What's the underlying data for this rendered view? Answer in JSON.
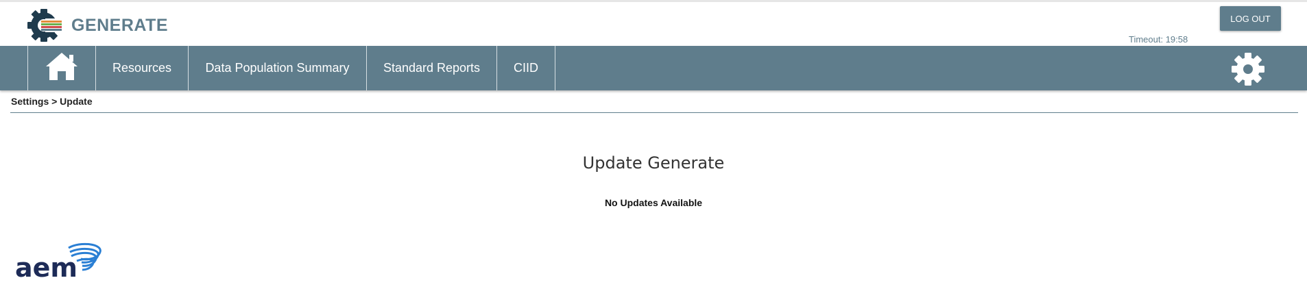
{
  "header": {
    "app_name": "GENERATE",
    "logout_label": "LOG OUT",
    "timeout_text": "Timeout: 19:58",
    "logo_icon": "generate-gear-logo-icon"
  },
  "nav": {
    "home_icon": "home-icon",
    "items": [
      {
        "label": "Resources"
      },
      {
        "label": "Data Population Summary"
      },
      {
        "label": "Standard Reports"
      },
      {
        "label": "CIID"
      }
    ],
    "settings_icon": "gear-icon"
  },
  "breadcrumb": "Settings > Update",
  "main": {
    "title": "Update Generate",
    "status": "No Updates Available"
  },
  "footer": {
    "brand": "aem"
  },
  "colors": {
    "nav_background": "#5f7d8c",
    "brand_text": "#5f7d8c",
    "logo_dark": "#1f3b4d",
    "aem_navy": "#1d2b57",
    "aem_blue": "#2a7fd4"
  }
}
